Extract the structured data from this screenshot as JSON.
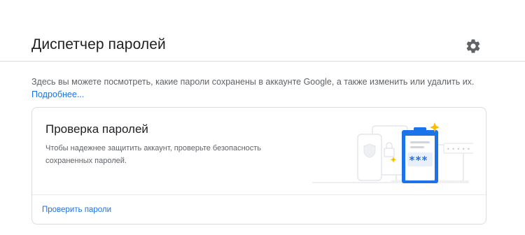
{
  "header": {
    "title": "Диспетчер паролей",
    "settings_icon": "gear-icon"
  },
  "intro": {
    "text": "Здесь вы можете посмотреть, какие пароли сохранены в аккаунте Google, а также изменить или удалить их.",
    "link": "Подробнее..."
  },
  "check_card": {
    "title": "Проверка паролей",
    "description": "Чтобы надежнее защитить аккаунт, проверьте безопасность сохраненных паролей.",
    "action_label": "Проверить пароли",
    "illustration_password": "***",
    "illustration_hidden": "• • • • •"
  },
  "colors": {
    "accent": "#1a73e8",
    "clipboard": "#1a73e8",
    "sparkle": "#fbbc04",
    "text_primary": "#202124",
    "text_secondary": "#5f6368",
    "divider": "#dadce0"
  }
}
